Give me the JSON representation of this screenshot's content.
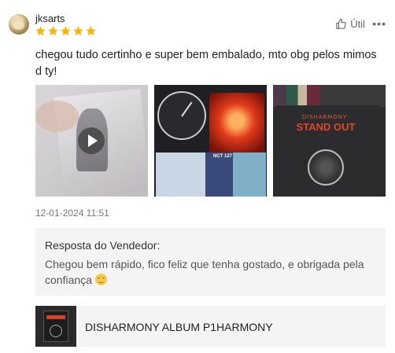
{
  "review": {
    "username": "jksarts",
    "rating": 5,
    "rating_max": 5,
    "star_color": "#f5b800",
    "helpful_label": "Útil",
    "more_label": "•••",
    "comment": "chegou tudo certinho e super bem embalado, mto obg pelos mimos d ty!",
    "media": [
      {
        "kind": "video",
        "icon": "play-icon"
      },
      {
        "kind": "image",
        "label": "NCT 127"
      },
      {
        "kind": "image",
        "label_top": "DISHARMONY:",
        "label_main": "STAND OUT"
      }
    ],
    "date": "12-01-2024 11:51"
  },
  "seller_reply": {
    "title": "Resposta do Vendedor:",
    "text": "Chegou bem rápido, fico feliz que tenha gostado, e obrigada pela confiança"
  },
  "product": {
    "name": "DISHARMONY ALBUM P1HARMONY"
  }
}
